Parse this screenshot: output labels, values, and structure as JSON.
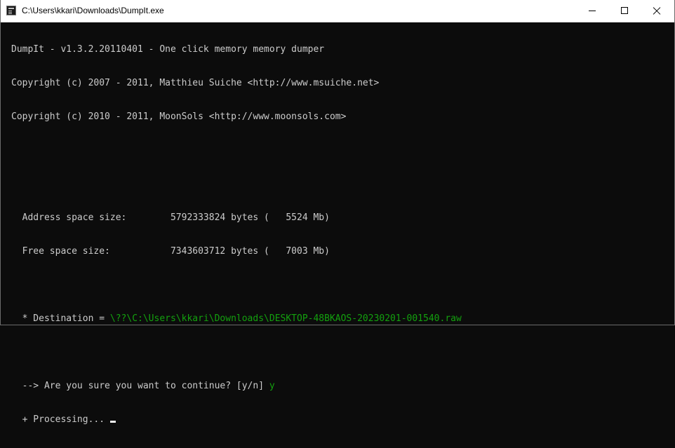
{
  "window": {
    "title": "C:\\Users\\kkari\\Downloads\\DumpIt.exe",
    "icon": "console-app-icon",
    "controls": [
      "minimize-icon",
      "maximize-icon",
      "close-icon"
    ]
  },
  "console": {
    "header": [
      "DumpIt - v1.3.2.20110401 - One click memory memory dumper",
      "Copyright (c) 2007 - 2011, Matthieu Suiche <http://www.msuiche.net>",
      "Copyright (c) 2010 - 2011, MoonSols <http://www.moonsols.com>"
    ],
    "address_space_line": "  Address space size:        5792333824 bytes (   5524 Mb)",
    "free_space_line": "  Free space size:           7343603712 bytes (   7003 Mb)",
    "destination_label": "  * Destination = ",
    "destination_path": "\\??\\C:\\Users\\kkari\\Downloads\\DESKTOP-48BKAOS-20230201-001540.raw",
    "prompt": "  --> Are you sure you want to continue? [y/n] ",
    "answer": "y",
    "processing": "  + Processing..."
  },
  "colors": {
    "background": "#0c0c0c",
    "text": "#cccccc",
    "highlight": "#13a10e"
  }
}
